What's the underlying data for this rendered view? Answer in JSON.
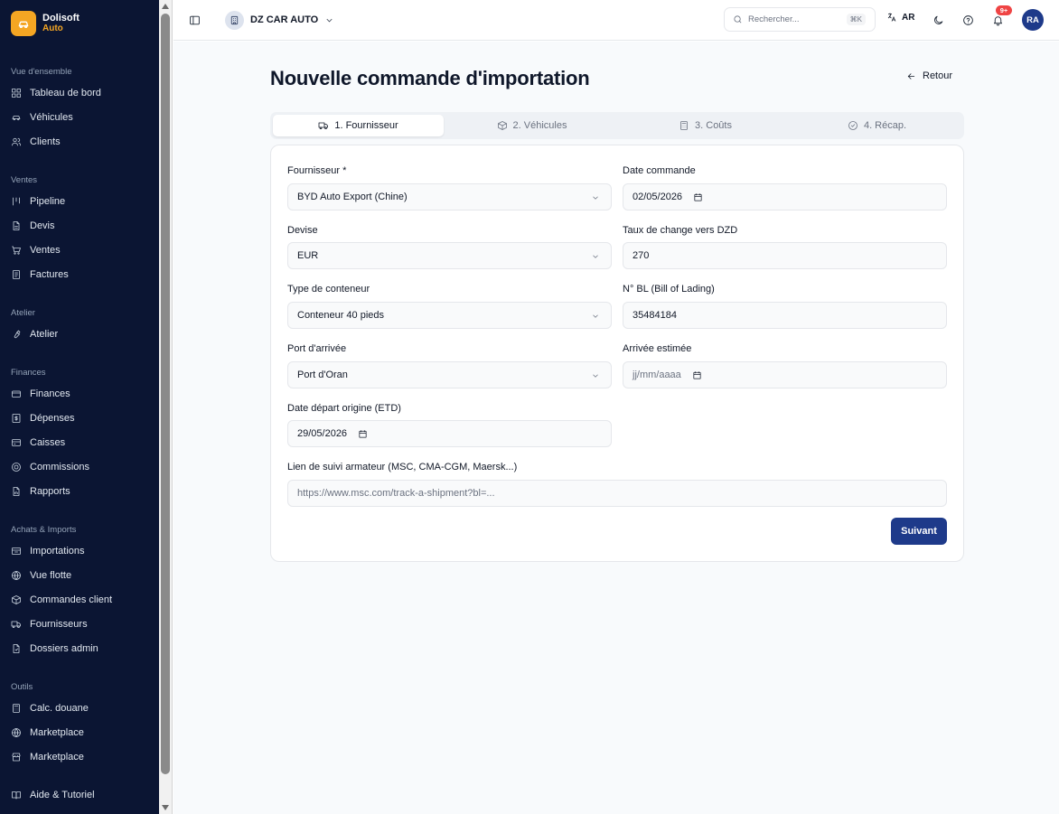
{
  "brand": {
    "name": "Dolisoft",
    "sub": "Auto"
  },
  "sidebar": {
    "sections": [
      {
        "title": "Vue d'ensemble",
        "items": [
          {
            "label": "Tableau de bord",
            "icon": "dashboard-icon"
          },
          {
            "label": "Véhicules",
            "icon": "car-icon"
          },
          {
            "label": "Clients",
            "icon": "users-icon"
          }
        ]
      },
      {
        "title": "Ventes",
        "items": [
          {
            "label": "Pipeline",
            "icon": "kanban-icon"
          },
          {
            "label": "Devis",
            "icon": "file-icon"
          },
          {
            "label": "Ventes",
            "icon": "cart-icon"
          },
          {
            "label": "Factures",
            "icon": "receipt-icon"
          }
        ]
      },
      {
        "title": "Atelier",
        "items": [
          {
            "label": "Atelier",
            "icon": "wrench-icon"
          }
        ]
      },
      {
        "title": "Finances",
        "items": [
          {
            "label": "Finances",
            "icon": "wallet-icon"
          },
          {
            "label": "Dépenses",
            "icon": "banknote-icon"
          },
          {
            "label": "Caisses",
            "icon": "cashbox-icon"
          },
          {
            "label": "Commissions",
            "icon": "coin-icon"
          },
          {
            "label": "Rapports",
            "icon": "report-icon"
          }
        ]
      },
      {
        "title": "Achats & Imports",
        "items": [
          {
            "label": "Importations",
            "icon": "ship-icon"
          },
          {
            "label": "Vue flotte",
            "icon": "globe-icon"
          },
          {
            "label": "Commandes client",
            "icon": "package-icon"
          },
          {
            "label": "Fournisseurs",
            "icon": "truck-icon"
          },
          {
            "label": "Dossiers admin",
            "icon": "folder-file-icon"
          }
        ]
      },
      {
        "title": "Outils",
        "items": [
          {
            "label": "Calc. douane",
            "icon": "calculator-icon"
          },
          {
            "label": "Marketplace",
            "icon": "globe-icon"
          },
          {
            "label": "Marketplace",
            "icon": "store-icon"
          }
        ]
      }
    ],
    "help": {
      "label": "Aide & Tutoriel",
      "icon": "book-icon"
    }
  },
  "header": {
    "company": "DZ CAR AUTO",
    "search_placeholder": "Rechercher...",
    "search_shortcut": "⌘K",
    "language": "AR",
    "notifications_badge": "9+",
    "user_initials": "RA"
  },
  "page": {
    "title": "Nouvelle commande d'importation",
    "back_label": "Retour",
    "tabs": [
      {
        "label": "1. Fournisseur",
        "icon": "truck-icon",
        "active": true
      },
      {
        "label": "2. Véhicules",
        "icon": "package-icon",
        "active": false
      },
      {
        "label": "3. Coûts",
        "icon": "calculator-icon",
        "active": false
      },
      {
        "label": "4. Récap.",
        "icon": "check-circle-icon",
        "active": false
      }
    ],
    "form": {
      "supplier": {
        "label": "Fournisseur *",
        "value": "BYD Auto Export (Chine)"
      },
      "order_date": {
        "label": "Date commande",
        "value": "02/05/2026"
      },
      "currency": {
        "label": "Devise",
        "value": "EUR"
      },
      "exchange_rate": {
        "label": "Taux de change vers DZD",
        "value": "270"
      },
      "container_type": {
        "label": "Type de conteneur",
        "value": "Conteneur 40 pieds"
      },
      "bl_number": {
        "label": "N° BL (Bill of Lading)",
        "value": "35484184"
      },
      "arrival_port": {
        "label": "Port d'arrivée",
        "value": "Port d'Oran"
      },
      "estimated_arrival": {
        "label": "Arrivée estimée",
        "placeholder": "jj/mm/aaaa"
      },
      "departure_date": {
        "label": "Date départ origine (ETD)",
        "value": "29/05/2026"
      },
      "tracking_link": {
        "label": "Lien de suivi armateur (MSC, CMA-CGM, Maersk...)",
        "placeholder": "https://www.msc.com/track-a-shipment?bl=..."
      },
      "next_label": "Suivant"
    }
  }
}
